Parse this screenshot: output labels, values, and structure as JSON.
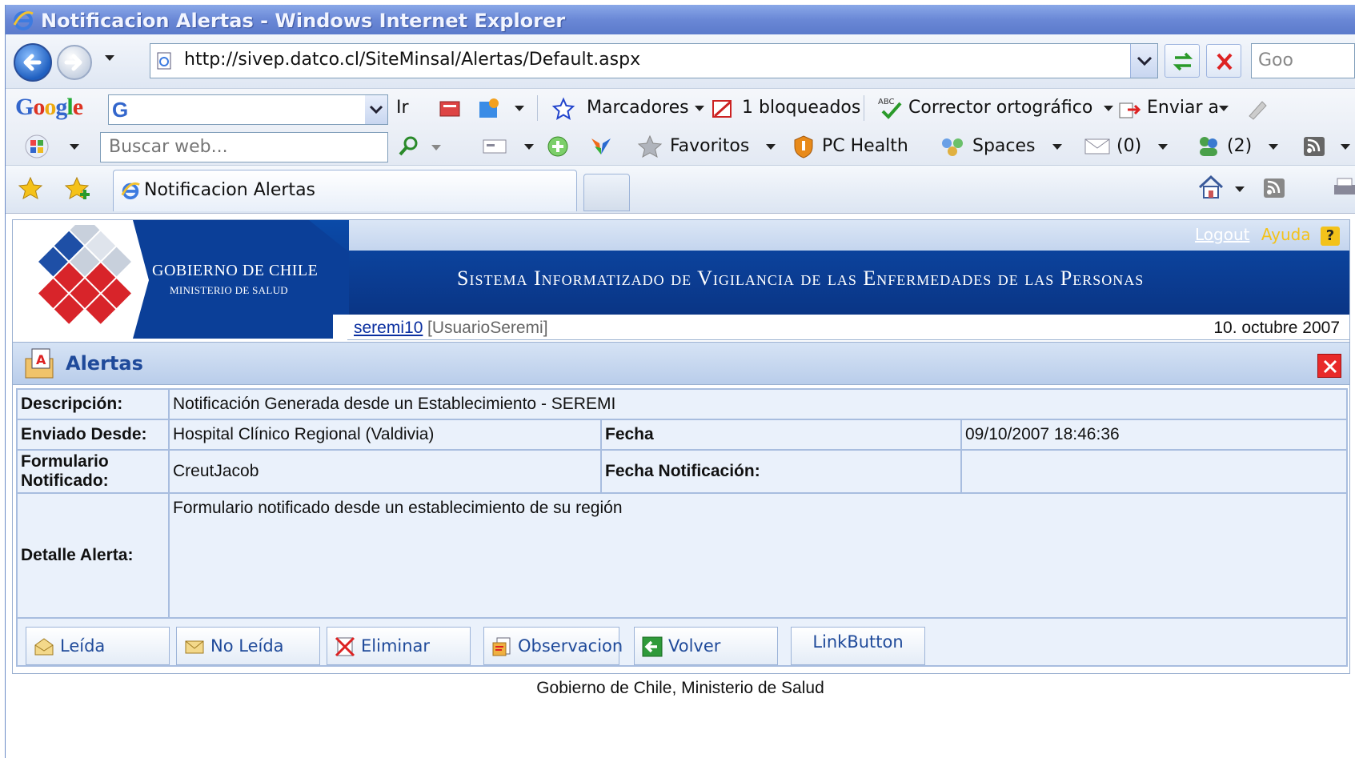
{
  "window": {
    "title": "Notificacion Alertas - Windows Internet Explorer"
  },
  "address": {
    "url": "http://sivep.datco.cl/SiteMinsal/Alertas/Default.aspx",
    "search_placeholder": "Goo"
  },
  "google_toolbar": {
    "go_label": "Ir",
    "bookmarks_label": "Marcadores",
    "blocked_label": "1 bloqueados",
    "spell_label": "Corrector ortográfico",
    "send_label": "Enviar a"
  },
  "live_toolbar": {
    "search_placeholder": "Buscar web...",
    "favorites_label": "Favoritos",
    "pchealth_label": "PC Health",
    "spaces_label": "Spaces",
    "mail_count": "(0)",
    "contacts_count": "(2)"
  },
  "tab": {
    "label": "Notificacion Alertas"
  },
  "header": {
    "org_line1": "GOBIERNO DE CHILE",
    "org_line2": "MINISTERIO DE SALUD",
    "system_title": "Sistema Informatizado de Vigilancia de las Enfermedades de las Personas",
    "logout_label": "Logout",
    "help_label": "Ayuda",
    "user": "seremi10",
    "role": "[UsuarioSeremi]",
    "date": "10. octubre 2007"
  },
  "panel": {
    "title": "Alertas",
    "fields": {
      "descripcion_label": "Descripción:",
      "descripcion_value": "Notificación Generada desde un Establecimiento - SEREMI",
      "enviado_label": "Enviado Desde:",
      "enviado_value": "Hospital Clínico Regional (Valdivia)",
      "fecha_label": "Fecha",
      "fecha_value": "09/10/2007 18:46:36",
      "formulario_label": "Formulario Notificado:",
      "formulario_value": "CreutJacob",
      "fecha_notif_label": "Fecha Notificación:",
      "fecha_notif_value": "",
      "detalle_label": "Detalle Alerta:",
      "detalle_value": "Formulario notificado desde un establecimiento de su región"
    },
    "buttons": {
      "leida": "Leída",
      "no_leida": "No Leída",
      "eliminar": "Eliminar",
      "observacion": "Observacion",
      "volver": "Volver",
      "link": "LinkButton"
    }
  },
  "footer": {
    "text": "Gobierno de Chile, Ministerio de Salud"
  }
}
